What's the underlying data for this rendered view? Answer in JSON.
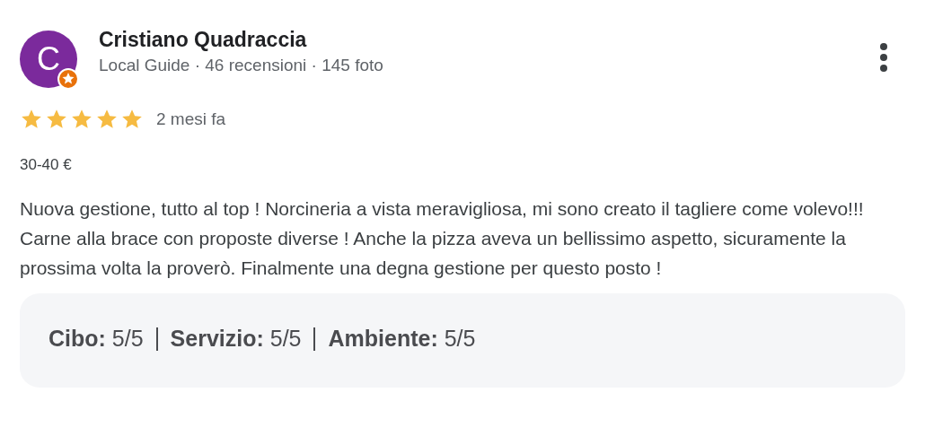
{
  "review": {
    "avatar_initial": "C",
    "author": "Cristiano Quadraccia",
    "author_meta": "Local Guide · 46 recensioni · 145 foto",
    "stars": 5,
    "time": "2 mesi fa",
    "price": "30-40 €",
    "text": "Nuova gestione, tutto al top ! Norcineria a vista meravigliosa, mi sono creato il tagliere come volevo!!! Carne alla brace con proposte diverse ! Anche la pizza aveva un bellissimo aspetto, sicuramente la prossima volta la proverò. Finalmente una degna gestione per questo posto !",
    "ratings": [
      {
        "text": "**Cibo:** 5/5"
      },
      {
        "text": "**Servizio:** 5/5"
      },
      {
        "text": "**Ambiente:** 5/5"
      }
    ]
  }
}
